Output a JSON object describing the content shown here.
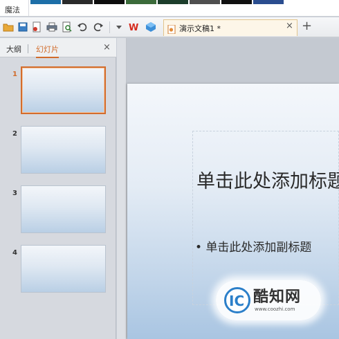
{
  "ribbon": {
    "magic_tab": "魔法"
  },
  "document_tab": {
    "title": "演示文稿1 *"
  },
  "left_pane": {
    "tabs": [
      {
        "label": "大纲"
      },
      {
        "label": "幻灯片"
      }
    ],
    "slides": [
      {
        "number": "1"
      },
      {
        "number": "2"
      },
      {
        "number": "3"
      },
      {
        "number": "4"
      }
    ]
  },
  "slide": {
    "title_placeholder": "单击此处添加标题",
    "subtitle_placeholder": "单击此处添加副标题"
  },
  "watermark": {
    "brand": "酷知网",
    "url": "www.coozhi.com"
  }
}
